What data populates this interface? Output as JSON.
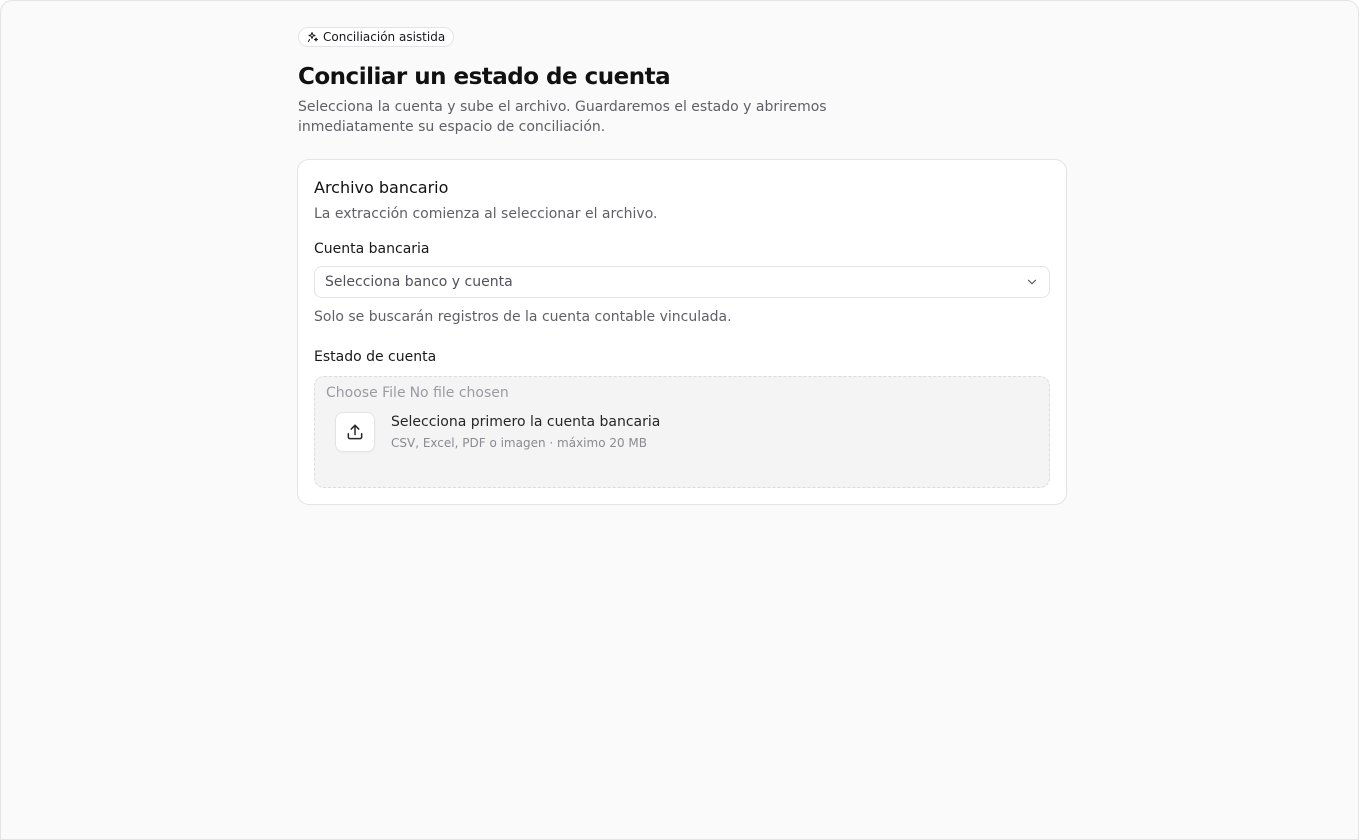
{
  "header": {
    "badge_label": "Conciliación asistida",
    "title": "Conciliar un estado de cuenta",
    "subtitle": "Selecciona la cuenta y sube el archivo. Guardaremos el estado y abriremos inmediatamente su espacio de conciliación."
  },
  "card": {
    "title": "Archivo bancario",
    "description": "La extracción comienza al seleccionar el archivo.",
    "account_field": {
      "label": "Cuenta bancaria",
      "placeholder": "Selecciona banco y cuenta",
      "help": "Solo se buscarán registros de la cuenta contable vinculada."
    },
    "statement_field": {
      "label": "Estado de cuenta",
      "choose_file_label": "Choose File",
      "no_file_label": "No file chosen",
      "drop_title": "Selecciona primero la cuenta bancaria",
      "drop_hint": "CSV, Excel, PDF o imagen · máximo 20 MB"
    }
  },
  "icons": {
    "badge": "sparkles-icon",
    "select": "chevron-down-icon",
    "upload": "upload-icon"
  }
}
